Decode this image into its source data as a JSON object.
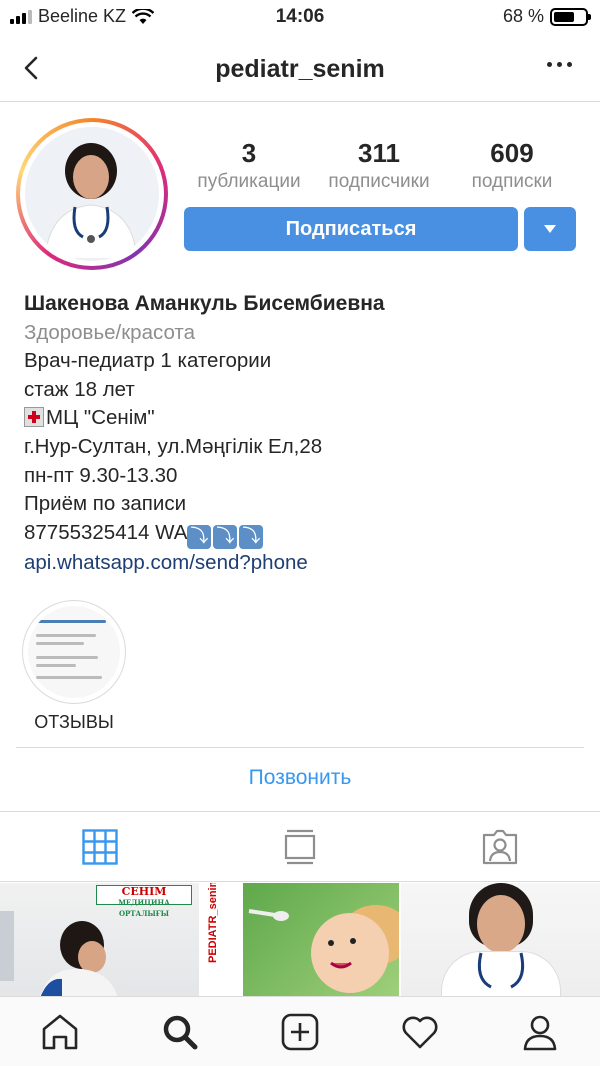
{
  "status_bar": {
    "carrier": "Beeline KZ",
    "time": "14:06",
    "battery": "68 %",
    "battery_level": 0.68
  },
  "header": {
    "username": "pediatr_senim"
  },
  "profile": {
    "stats": [
      {
        "value": "3",
        "label": "публикации"
      },
      {
        "value": "311",
        "label": "подписчики"
      },
      {
        "value": "609",
        "label": "подписки"
      }
    ],
    "follow_label": "Подписаться"
  },
  "bio": {
    "name": "Шакенова Аманкуль Бисембиевна",
    "category": "Здоровье/красота",
    "line1": "Врач-педиатр 1 категории",
    "line2": "стаж 18 лет",
    "line3": "МЦ \"Сенім\"",
    "line4": "г.Нур-Султан, ул.Мәңгілік Ел,28",
    "line5": "пн-пт 9.30-13.30",
    "line6": "Приём по записи",
    "line7": "87755325414 WA",
    "link": "api.whatsapp.com/send?phone"
  },
  "highlights": [
    {
      "label": "ОТЗЫВЫ"
    }
  ],
  "call_label": "Позвонить",
  "grid": {
    "post1_badge": "СЕНІМ",
    "post1_badge_sub": "МЕДИЦИНА ОРТАЛЫҒЫ",
    "post2_brand": "PEDIATR_senim"
  },
  "colors": {
    "primary": "#4a90e2",
    "link": "#3897f0"
  },
  "icons": {
    "tabs": [
      "grid-icon",
      "feed-icon",
      "tagged-icon"
    ],
    "nav": [
      "home-icon",
      "search-icon",
      "add-icon",
      "heart-icon",
      "profile-icon"
    ]
  }
}
